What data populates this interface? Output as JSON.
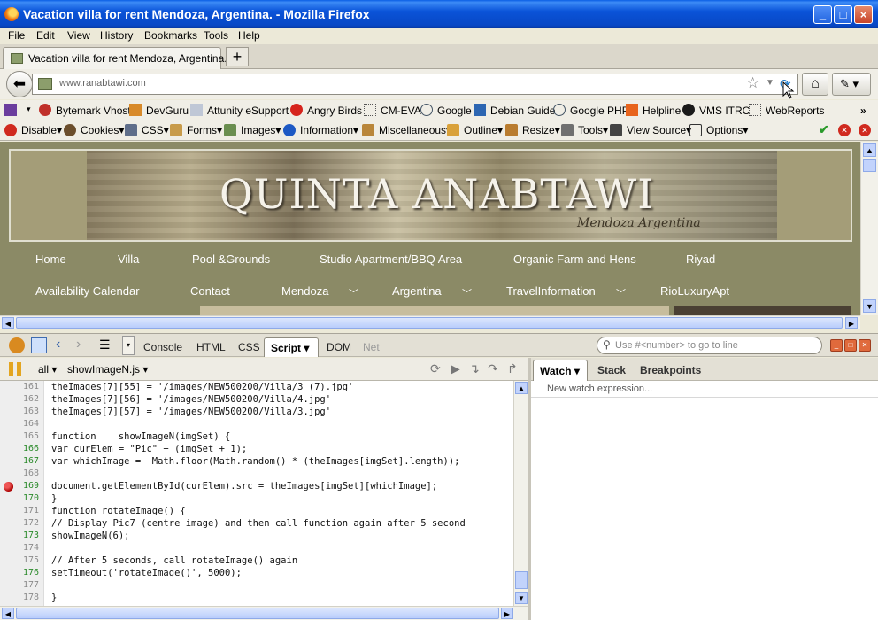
{
  "window": {
    "title": "Vacation villa for rent Mendoza, Argentina. - Mozilla Firefox"
  },
  "menu": [
    "File",
    "Edit",
    "View",
    "History",
    "Bookmarks",
    "Tools",
    "Help"
  ],
  "tab": {
    "label": "Vacation villa for rent Mendoza, Argentina."
  },
  "nav": {
    "url": "www.ranabtawi.com"
  },
  "bookmarks": [
    "Bytemark Vhost",
    "DevGuru",
    "Attunity eSupport",
    "Angry Birds",
    "CM-EVA",
    "Google",
    "Debian Guide",
    "Google PHP",
    "Helpline",
    "VMS ITRC",
    "WebReports"
  ],
  "webdev": [
    "Disable",
    "Cookies",
    "CSS",
    "Forms",
    "Images",
    "Information",
    "Miscellaneous",
    "Outline",
    "Resize",
    "Tools",
    "View Source",
    "Options"
  ],
  "site": {
    "title": "QUINTA ANABTAWI",
    "subtitle": "Mendoza Argentina",
    "nav_row1": [
      "Home",
      "Villa",
      "Pool &Grounds",
      "Studio Apartment/BBQ Area",
      "Organic Farm and Hens",
      "Riyad"
    ],
    "nav_row2": [
      "Availability Calendar",
      "Contact",
      "Mendoza",
      "Argentina",
      "TravelInformation",
      "RioLuxuryApt"
    ]
  },
  "firebug": {
    "tabs": [
      "Console",
      "HTML",
      "CSS",
      "Script",
      "DOM",
      "Net"
    ],
    "active_tab": "Script",
    "search_placeholder": "Use #<number> to go to line",
    "filter": "all",
    "file": "showImageN.js",
    "side_tabs": [
      "Watch",
      "Stack",
      "Breakpoints"
    ],
    "watch_placeholder": "New watch expression...",
    "breakpoint_line": "169",
    "code": [
      {
        "n": "161",
        "t": "theImages[7][55] = '/images/NEW500200/Villa/3 (7).jpg'",
        "exec": false
      },
      {
        "n": "162",
        "t": "theImages[7][56] = '/images/NEW500200/Villa/4.jpg'",
        "exec": false
      },
      {
        "n": "163",
        "t": "theImages[7][57] = '/images/NEW500200/Villa/3.jpg'",
        "exec": false
      },
      {
        "n": "164",
        "t": "",
        "exec": false
      },
      {
        "n": "165",
        "t": "function    showImageN(imgSet) {",
        "exec": false
      },
      {
        "n": "166",
        "t": "var curElem = \"Pic\" + (imgSet + 1);",
        "exec": true
      },
      {
        "n": "167",
        "t": "var whichImage =  Math.floor(Math.random() * (theImages[imgSet].length));",
        "exec": true
      },
      {
        "n": "168",
        "t": "",
        "exec": false
      },
      {
        "n": "169",
        "t": "document.getElementById(curElem).src = theImages[imgSet][whichImage];",
        "exec": true
      },
      {
        "n": "170",
        "t": "}",
        "exec": true
      },
      {
        "n": "171",
        "t": "function rotateImage() {",
        "exec": false
      },
      {
        "n": "172",
        "t": "// Display Pic7 (centre image) and then call function again after 5 second",
        "exec": false
      },
      {
        "n": "173",
        "t": "showImageN(6);",
        "exec": true
      },
      {
        "n": "174",
        "t": "",
        "exec": false
      },
      {
        "n": "175",
        "t": "// After 5 seconds, call rotateImage() again",
        "exec": false
      },
      {
        "n": "176",
        "t": "setTimeout('rotateImage()', 5000);",
        "exec": true
      },
      {
        "n": "177",
        "t": "",
        "exec": false
      },
      {
        "n": "178",
        "t": "}",
        "exec": false
      }
    ]
  }
}
